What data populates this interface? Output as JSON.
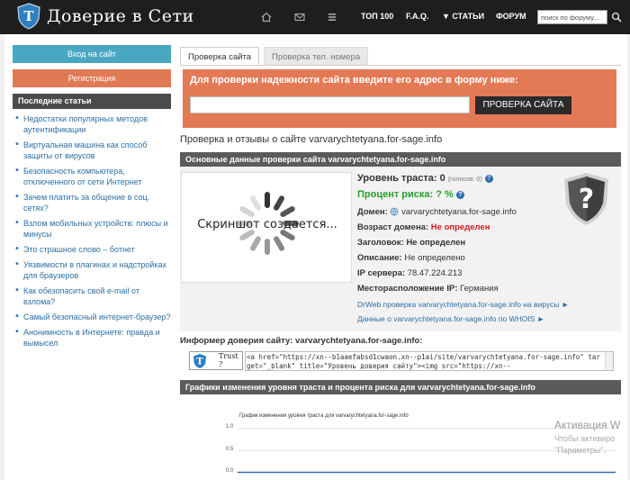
{
  "header": {
    "site_title": "Доверие в Сети",
    "nav": {
      "home_icon": "home-icon",
      "mail_icon": "mail-icon",
      "list_icon": "list-icon",
      "top100": "ТОП 100",
      "faq": "F.A.Q.",
      "articles": "▼ СТАТЬИ",
      "forum": "ФОРУМ"
    },
    "search_placeholder": "поиск по форуму..."
  },
  "sidebar": {
    "login": "Вход на сайт",
    "register": "Регистрация",
    "recent_heading": "Последние статьи",
    "articles": [
      "Недостатки популярных методов аутентификации",
      "Виртуальная машина как способ защиты от вирусов",
      "Безопасность компьютера, отключенного от сети Интернет",
      "Зачем платить за общение в соц. сетях?",
      "Взлом мобильных устройств: плюсы и минусы",
      "Это страшное слово – ботнет",
      "Уязвимости в плагинах и надстройках для браузеров",
      "Как обезопасить свой e-mail от взлома?",
      "Самый безопасный интернет-браузер?",
      "Анонимность в Интернете: правда и вымысел"
    ]
  },
  "tabs": {
    "check_site": "Проверка сайта",
    "check_phone": "Проверка тел. номера"
  },
  "check_form": {
    "title": "Для проверки надежности сайта введите его адрес в форму ниже:",
    "input_value": "",
    "button": "ПРОВЕРКА САЙТА"
  },
  "main": {
    "title": "Проверка и отзывы о сайте varvarychtetyana.for-sage.info",
    "section_title": "Основные данные проверки сайта varvarychtetyana.for-sage.info",
    "screenshot_text": "Скриншот создается...",
    "trust_label": "Уровень траста:",
    "trust_value": "0",
    "trust_votes": "(голосов: 0)",
    "risk_label": "Процент риска: ? %",
    "domain_label": "Домен:",
    "domain_value": "varvarychtetyana.for-sage.info",
    "age_label": "Возраст домена:",
    "age_value": "Не определен",
    "heading_label": "Заголовок:",
    "heading_value": "Не определен",
    "desc_label": "Описание:",
    "desc_value": "Не определено",
    "ip_label": "IP сервера:",
    "ip_value": "78.47.224.213",
    "location_label": "Месторасположение IP:",
    "location_value": "Германия",
    "drweb_link": "DrWeb проверка varvarychtetyana.for-sage.info на вирусы ►",
    "whois_link": "Данные о varvarychtetyana.for-sage.info по WHOIS ►",
    "shield_icon": "question-shield-icon"
  },
  "informer": {
    "title": "Информер доверия сайту: varvarychtetyana.for-sage.info:",
    "badge_text": "Trust ?",
    "code": "<a href=\"https://xn--b1aaefabsd1cwaon.xn--p1ai/site/varvarychtetyana.for-sage.info\" target=\"_blank\" title=\"Уровень доверия сайту\"><img src=\"https://xn--"
  },
  "graphs": {
    "section_title": "Графики изменения уровня траста и процента риска для varvarychtetyana.for-sage.info"
  },
  "chart_data": {
    "type": "line",
    "title": "График изменения уровня траста для varvarychtetyana.for-sage.info",
    "y_ticks": [
      "1.0",
      "0.5",
      "0.0"
    ],
    "ylim": [
      0,
      1
    ],
    "series": [
      {
        "values": [
          0,
          0
        ]
      }
    ]
  },
  "watermark": {
    "line1": "Активация W",
    "line2": "Чтобы активиро",
    "line3": "\"Параметры\"."
  }
}
